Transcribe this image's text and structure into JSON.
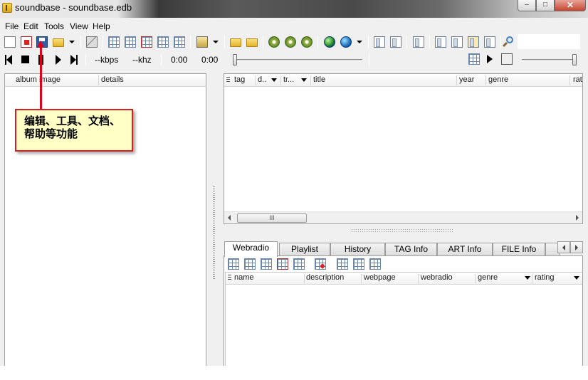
{
  "window": {
    "title": "soundbase - soundbase.edb",
    "controls": {
      "minimize": "‒",
      "maximize": "□",
      "close": "✕"
    }
  },
  "menu": [
    "File",
    "Edit",
    "Tools",
    "View",
    "Help"
  ],
  "player": {
    "bitrate": "--kbps",
    "samplerate": "--khz",
    "elapsed": "0:00",
    "total": "0:00"
  },
  "left_panel": {
    "columns": [
      "album image",
      "details"
    ]
  },
  "track_list": {
    "columns": [
      "tag",
      "d..",
      "tr...",
      "title",
      "year",
      "genre",
      "rat"
    ],
    "scroll_thumb": "III"
  },
  "tabs": [
    "Webradio",
    "Playlist",
    "History",
    "TAG Info",
    "ART Info",
    "FILE Info"
  ],
  "active_tab": "Webradio",
  "webradio": {
    "columns": [
      "name",
      "description",
      "webpage",
      "webradio",
      "genre",
      "rating"
    ]
  },
  "annotation": {
    "text": "编辑、工具、文档、帮助等功能",
    "color": "#e0001a",
    "box_bg": "#ffffc6"
  }
}
